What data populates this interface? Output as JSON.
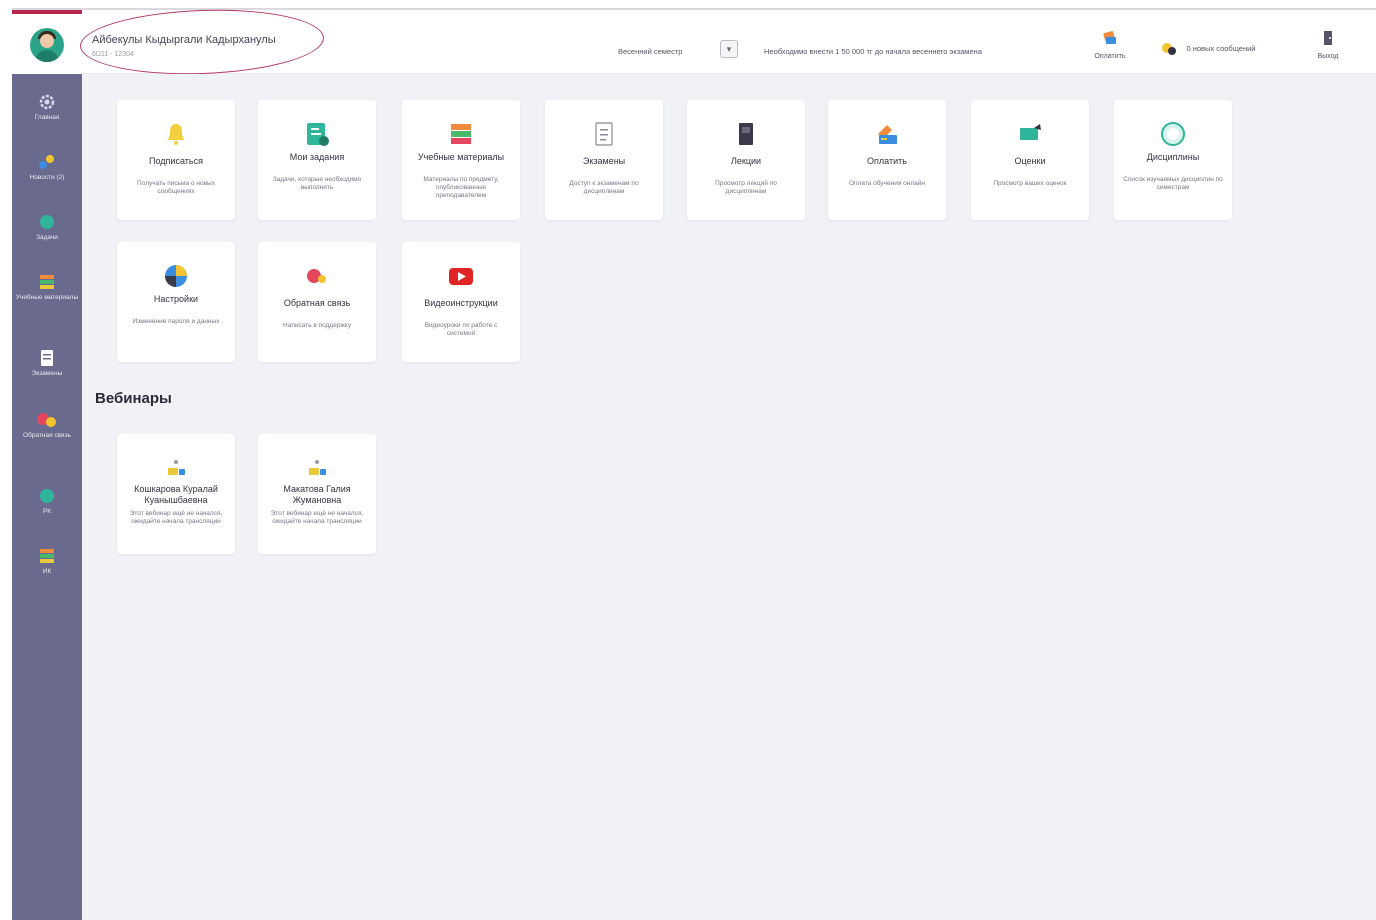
{
  "header": {
    "user_name": "Айбекулы Кыдыргали Кадырханулы",
    "user_id": "6D11 - 12304",
    "period_label": "Весенний семестр",
    "period_value": "▾",
    "debt_text": "Необходимо внести 1 50 000 тг до начала весеннего экзамена",
    "pay_label": "Оплатить",
    "messages_label": "0 новых сообщений",
    "exit_label": "Выход"
  },
  "sidebar": {
    "items": [
      {
        "label": "Главная",
        "icon": "gear-icon"
      },
      {
        "label": "Новости (2)",
        "icon": "news-icon"
      },
      {
        "label": "Задачи",
        "icon": "tasks-icon"
      },
      {
        "label": "Учебные материалы",
        "icon": "books-icon"
      },
      {
        "label": "Экзамены",
        "icon": "exam-icon"
      },
      {
        "label": "Обратная связь",
        "icon": "feedback-icon"
      },
      {
        "label": "РК",
        "icon": "rk-icon"
      },
      {
        "label": "ИК",
        "icon": "ik-icon"
      }
    ]
  },
  "tiles": [
    {
      "title": "Подписаться",
      "desc": "Получать письма о новых сообщениях",
      "icon": "bell-icon"
    },
    {
      "title": "Мои задания",
      "desc": "Задачи, которые необходимо выполнить",
      "icon": "assignments-icon"
    },
    {
      "title": "Учебные материалы",
      "desc": "Материалы по предмету, опубликованные преподавателем",
      "icon": "books-icon"
    },
    {
      "title": "Экзамены",
      "desc": "Доступ к экзаменам по дисциплинам",
      "icon": "exam-icon"
    },
    {
      "title": "Лекции",
      "desc": "Просмотр лекций по дисциплинам",
      "icon": "lecture-icon"
    },
    {
      "title": "Оплатить",
      "desc": "Оплата обучения онлайн",
      "icon": "payment-icon"
    },
    {
      "title": "Оценки",
      "desc": "Просмотр ваших оценок",
      "icon": "grades-icon"
    },
    {
      "title": "Дисциплины",
      "desc": "Список изучаемых дисциплин по семестрам",
      "icon": "disciplines-icon"
    },
    {
      "title": "Настройки",
      "desc": "Изменение пароля и данных",
      "icon": "settings-icon"
    },
    {
      "title": "Обратная связь",
      "desc": "Написать в поддержку",
      "icon": "feedback-icon"
    },
    {
      "title": "Видеоинструкции",
      "desc": "Видеоуроки по работе с системой",
      "icon": "youtube-icon"
    }
  ],
  "webinars": {
    "title": "Вебинары",
    "items": [
      {
        "name": "Кошкарова Куралай Куанышбаевна",
        "desc": "Этот вебинар ещё не начался, ожидайте начала трансляции"
      },
      {
        "name": "Макатова Галия Жумановна",
        "desc": "Этот вебинар ещё не начался, ожидайте начала трансляции"
      }
    ]
  },
  "colors": {
    "sidebar": "#6a6a8e",
    "accent": "#b5284b",
    "background": "#f1f2f6",
    "green": "#2aa488"
  }
}
